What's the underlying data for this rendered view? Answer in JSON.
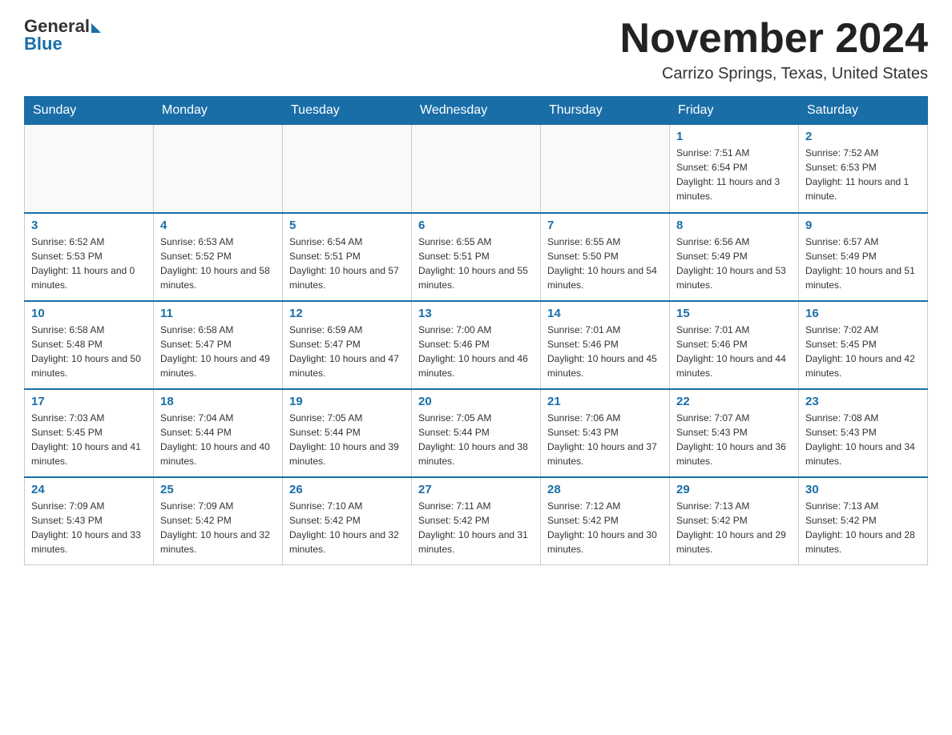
{
  "header": {
    "logo_general": "General",
    "logo_blue": "Blue",
    "month_title": "November 2024",
    "location": "Carrizo Springs, Texas, United States"
  },
  "weekdays": [
    "Sunday",
    "Monday",
    "Tuesday",
    "Wednesday",
    "Thursday",
    "Friday",
    "Saturday"
  ],
  "weeks": [
    [
      {
        "day": "",
        "info": ""
      },
      {
        "day": "",
        "info": ""
      },
      {
        "day": "",
        "info": ""
      },
      {
        "day": "",
        "info": ""
      },
      {
        "day": "",
        "info": ""
      },
      {
        "day": "1",
        "info": "Sunrise: 7:51 AM\nSunset: 6:54 PM\nDaylight: 11 hours and 3 minutes."
      },
      {
        "day": "2",
        "info": "Sunrise: 7:52 AM\nSunset: 6:53 PM\nDaylight: 11 hours and 1 minute."
      }
    ],
    [
      {
        "day": "3",
        "info": "Sunrise: 6:52 AM\nSunset: 5:53 PM\nDaylight: 11 hours and 0 minutes."
      },
      {
        "day": "4",
        "info": "Sunrise: 6:53 AM\nSunset: 5:52 PM\nDaylight: 10 hours and 58 minutes."
      },
      {
        "day": "5",
        "info": "Sunrise: 6:54 AM\nSunset: 5:51 PM\nDaylight: 10 hours and 57 minutes."
      },
      {
        "day": "6",
        "info": "Sunrise: 6:55 AM\nSunset: 5:51 PM\nDaylight: 10 hours and 55 minutes."
      },
      {
        "day": "7",
        "info": "Sunrise: 6:55 AM\nSunset: 5:50 PM\nDaylight: 10 hours and 54 minutes."
      },
      {
        "day": "8",
        "info": "Sunrise: 6:56 AM\nSunset: 5:49 PM\nDaylight: 10 hours and 53 minutes."
      },
      {
        "day": "9",
        "info": "Sunrise: 6:57 AM\nSunset: 5:49 PM\nDaylight: 10 hours and 51 minutes."
      }
    ],
    [
      {
        "day": "10",
        "info": "Sunrise: 6:58 AM\nSunset: 5:48 PM\nDaylight: 10 hours and 50 minutes."
      },
      {
        "day": "11",
        "info": "Sunrise: 6:58 AM\nSunset: 5:47 PM\nDaylight: 10 hours and 49 minutes."
      },
      {
        "day": "12",
        "info": "Sunrise: 6:59 AM\nSunset: 5:47 PM\nDaylight: 10 hours and 47 minutes."
      },
      {
        "day": "13",
        "info": "Sunrise: 7:00 AM\nSunset: 5:46 PM\nDaylight: 10 hours and 46 minutes."
      },
      {
        "day": "14",
        "info": "Sunrise: 7:01 AM\nSunset: 5:46 PM\nDaylight: 10 hours and 45 minutes."
      },
      {
        "day": "15",
        "info": "Sunrise: 7:01 AM\nSunset: 5:46 PM\nDaylight: 10 hours and 44 minutes."
      },
      {
        "day": "16",
        "info": "Sunrise: 7:02 AM\nSunset: 5:45 PM\nDaylight: 10 hours and 42 minutes."
      }
    ],
    [
      {
        "day": "17",
        "info": "Sunrise: 7:03 AM\nSunset: 5:45 PM\nDaylight: 10 hours and 41 minutes."
      },
      {
        "day": "18",
        "info": "Sunrise: 7:04 AM\nSunset: 5:44 PM\nDaylight: 10 hours and 40 minutes."
      },
      {
        "day": "19",
        "info": "Sunrise: 7:05 AM\nSunset: 5:44 PM\nDaylight: 10 hours and 39 minutes."
      },
      {
        "day": "20",
        "info": "Sunrise: 7:05 AM\nSunset: 5:44 PM\nDaylight: 10 hours and 38 minutes."
      },
      {
        "day": "21",
        "info": "Sunrise: 7:06 AM\nSunset: 5:43 PM\nDaylight: 10 hours and 37 minutes."
      },
      {
        "day": "22",
        "info": "Sunrise: 7:07 AM\nSunset: 5:43 PM\nDaylight: 10 hours and 36 minutes."
      },
      {
        "day": "23",
        "info": "Sunrise: 7:08 AM\nSunset: 5:43 PM\nDaylight: 10 hours and 34 minutes."
      }
    ],
    [
      {
        "day": "24",
        "info": "Sunrise: 7:09 AM\nSunset: 5:43 PM\nDaylight: 10 hours and 33 minutes."
      },
      {
        "day": "25",
        "info": "Sunrise: 7:09 AM\nSunset: 5:42 PM\nDaylight: 10 hours and 32 minutes."
      },
      {
        "day": "26",
        "info": "Sunrise: 7:10 AM\nSunset: 5:42 PM\nDaylight: 10 hours and 32 minutes."
      },
      {
        "day": "27",
        "info": "Sunrise: 7:11 AM\nSunset: 5:42 PM\nDaylight: 10 hours and 31 minutes."
      },
      {
        "day": "28",
        "info": "Sunrise: 7:12 AM\nSunset: 5:42 PM\nDaylight: 10 hours and 30 minutes."
      },
      {
        "day": "29",
        "info": "Sunrise: 7:13 AM\nSunset: 5:42 PM\nDaylight: 10 hours and 29 minutes."
      },
      {
        "day": "30",
        "info": "Sunrise: 7:13 AM\nSunset: 5:42 PM\nDaylight: 10 hours and 28 minutes."
      }
    ]
  ]
}
